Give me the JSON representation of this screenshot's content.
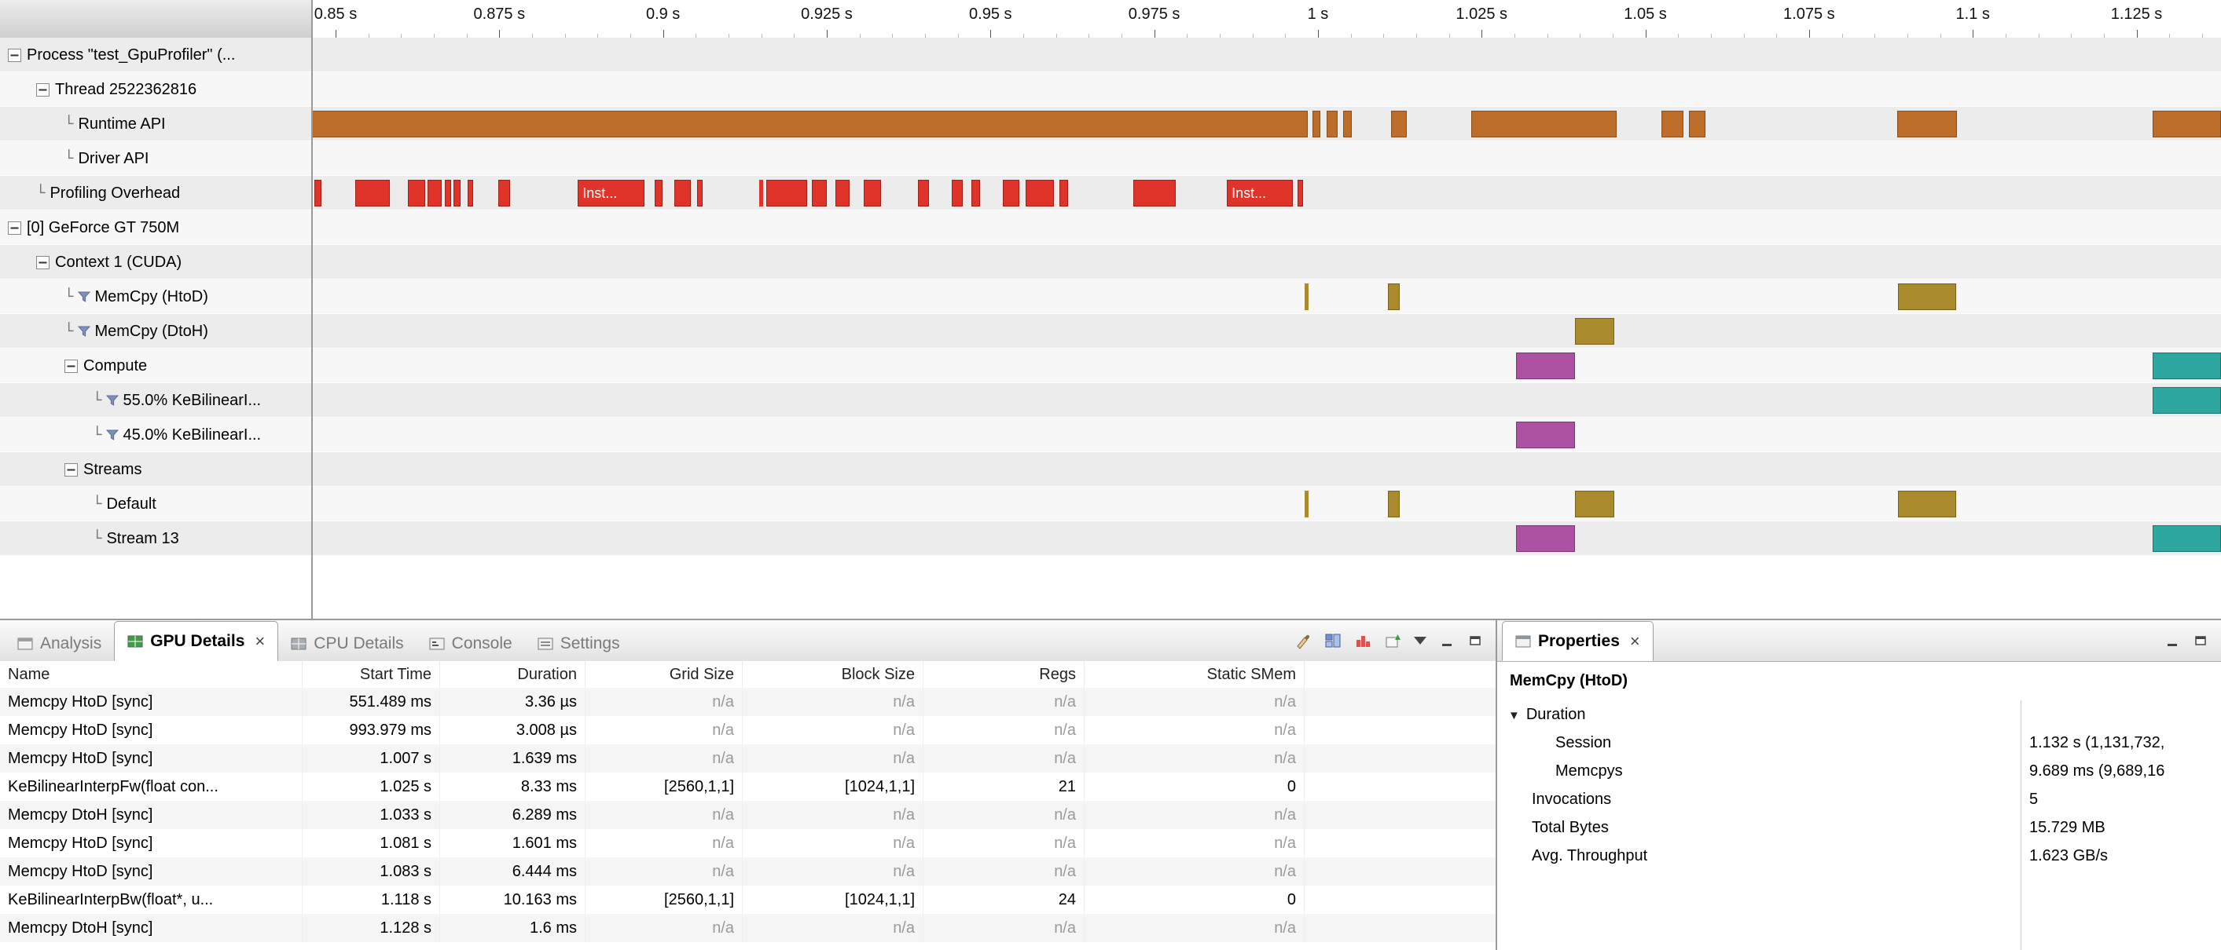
{
  "glyphs": {
    "close": "×",
    "leaf": "└",
    "arrow": "▼"
  },
  "palette": {
    "stripe_even": "#ececec",
    "stripe_odd": "#f7f7f7",
    "runtime": {
      "fill": "#bc6d2a",
      "edge": "#8a4e1c"
    },
    "overhead": {
      "fill": "#e0342a",
      "edge": "#9e2218"
    },
    "memcpy": {
      "fill": "#a98a2c",
      "edge": "#7a621e"
    },
    "kernel45": {
      "fill": "#ad51a2",
      "edge": "#7b3973"
    },
    "kernel55": {
      "fill": "#2da7a0",
      "edge": "#1d746f"
    }
  },
  "timeline": {
    "axis": {
      "start": 0.8464,
      "end": 1.1379
    },
    "ruler_ticks": [
      {
        "t": 0.85,
        "label": "0.85 s"
      },
      {
        "t": 0.875,
        "label": "0.875 s"
      },
      {
        "t": 0.9,
        "label": "0.9 s"
      },
      {
        "t": 0.925,
        "label": "0.925 s"
      },
      {
        "t": 0.95,
        "label": "0.95 s"
      },
      {
        "t": 0.975,
        "label": "0.975 s"
      },
      {
        "t": 1.0,
        "label": "1 s"
      },
      {
        "t": 1.025,
        "label": "1.025 s"
      },
      {
        "t": 1.05,
        "label": "1.05 s"
      },
      {
        "t": 1.075,
        "label": "1.075 s"
      },
      {
        "t": 1.1,
        "label": "1.1 s"
      },
      {
        "t": 1.125,
        "label": "1.125 s"
      }
    ],
    "rows": [
      {
        "id": "process",
        "label": "Process \"test_GpuProfiler\" (...",
        "depth": 0,
        "icon": "minus",
        "bars": []
      },
      {
        "id": "thread",
        "label": "Thread 2522362816",
        "depth": 1,
        "icon": "minus",
        "bars": []
      },
      {
        "id": "runtime-api",
        "label": "Runtime API",
        "depth": 2,
        "icon": "leaf",
        "bars": [
          {
            "s": 0.8464,
            "e": 0.9985,
            "c": "runtime"
          },
          {
            "s": 0.9992,
            "e": 1.0004,
            "c": "runtime"
          },
          {
            "s": 1.0013,
            "e": 1.003,
            "c": "runtime"
          },
          {
            "s": 1.0038,
            "e": 1.0052,
            "c": "runtime"
          },
          {
            "s": 1.0112,
            "e": 1.0136,
            "c": "runtime"
          },
          {
            "s": 1.0234,
            "e": 1.0456,
            "c": "runtime"
          },
          {
            "s": 1.0524,
            "e": 1.0558,
            "c": "runtime"
          },
          {
            "s": 1.0566,
            "e": 1.0592,
            "c": "runtime"
          },
          {
            "s": 1.0884,
            "e": 1.0976,
            "c": "runtime"
          },
          {
            "s": 1.1274,
            "e": 1.1379,
            "c": "runtime"
          }
        ]
      },
      {
        "id": "driver-api",
        "label": "Driver API",
        "depth": 2,
        "icon": "leaf",
        "bars": []
      },
      {
        "id": "profiling-overhead",
        "label": "Profiling Overhead",
        "depth": 1,
        "icon": "leaf",
        "bars": [
          {
            "s": 0.8468,
            "e": 0.8478,
            "c": "overhead"
          },
          {
            "s": 0.853,
            "e": 0.8583,
            "c": "overhead"
          },
          {
            "s": 0.861,
            "e": 0.8637,
            "c": "overhead"
          },
          {
            "s": 0.8641,
            "e": 0.8662,
            "c": "overhead"
          },
          {
            "s": 0.8667,
            "e": 0.8676,
            "c": "overhead"
          },
          {
            "s": 0.868,
            "e": 0.8691,
            "c": "overhead"
          },
          {
            "s": 0.8702,
            "e": 0.871,
            "c": "overhead"
          },
          {
            "s": 0.8748,
            "e": 0.8766,
            "c": "overhead"
          },
          {
            "s": 0.887,
            "e": 0.8972,
            "c": "overhead",
            "label": "Inst..."
          },
          {
            "s": 0.8987,
            "e": 0.8999,
            "c": "overhead"
          },
          {
            "s": 0.9017,
            "e": 0.9042,
            "c": "overhead"
          },
          {
            "s": 0.9052,
            "e": 0.9061,
            "c": "overhead"
          },
          {
            "s": 0.9147,
            "e": 0.9153,
            "c": "overhead"
          },
          {
            "s": 0.9158,
            "e": 0.922,
            "c": "overhead"
          },
          {
            "s": 0.9227,
            "e": 0.925,
            "c": "overhead"
          },
          {
            "s": 0.9263,
            "e": 0.9285,
            "c": "overhead"
          },
          {
            "s": 0.9306,
            "e": 0.9333,
            "c": "overhead"
          },
          {
            "s": 0.9389,
            "e": 0.9406,
            "c": "overhead"
          },
          {
            "s": 0.9441,
            "e": 0.9458,
            "c": "overhead"
          },
          {
            "s": 0.9471,
            "e": 0.9484,
            "c": "overhead"
          },
          {
            "s": 0.9519,
            "e": 0.9544,
            "c": "overhead"
          },
          {
            "s": 0.9554,
            "e": 0.9597,
            "c": "overhead"
          },
          {
            "s": 0.9605,
            "e": 0.9618,
            "c": "overhead"
          },
          {
            "s": 0.9718,
            "e": 0.9783,
            "c": "overhead"
          },
          {
            "s": 0.9861,
            "e": 0.9962,
            "c": "overhead",
            "label": "Inst..."
          },
          {
            "s": 0.9969,
            "e": 0.9977,
            "c": "overhead"
          }
        ]
      },
      {
        "id": "gpu",
        "label": "[0] GeForce GT 750M",
        "depth": 0,
        "icon": "minus",
        "bars": []
      },
      {
        "id": "context",
        "label": "Context 1 (CUDA)",
        "depth": 1,
        "icon": "minus",
        "bars": []
      },
      {
        "id": "memcpy-htod",
        "label": "MemCpy (HtoD)",
        "depth": 2,
        "icon": "leaf",
        "filter": true,
        "bars": [
          {
            "s": 0.998,
            "e": 0.9984,
            "c": "memcpy"
          },
          {
            "s": 1.0107,
            "e": 1.0125,
            "c": "memcpy"
          },
          {
            "s": 1.0886,
            "e": 1.0975,
            "c": "memcpy"
          }
        ]
      },
      {
        "id": "memcpy-dtoh",
        "label": "MemCpy (DtoH)",
        "depth": 2,
        "icon": "leaf",
        "filter": true,
        "bars": [
          {
            "s": 1.0393,
            "e": 1.0453,
            "c": "memcpy"
          }
        ]
      },
      {
        "id": "compute",
        "label": "Compute",
        "depth": 2,
        "icon": "minus",
        "bars": [
          {
            "s": 1.0302,
            "e": 1.0393,
            "c": "kernel45"
          },
          {
            "s": 1.1275,
            "e": 1.1379,
            "c": "kernel55"
          }
        ]
      },
      {
        "id": "kernel-55",
        "label": "55.0% KeBilinearI...",
        "depth": 3,
        "icon": "leaf",
        "filter": true,
        "bars": [
          {
            "s": 1.1275,
            "e": 1.1379,
            "c": "kernel55"
          }
        ]
      },
      {
        "id": "kernel-45",
        "label": "45.0% KeBilinearI...",
        "depth": 3,
        "icon": "leaf",
        "filter": true,
        "bars": [
          {
            "s": 1.0302,
            "e": 1.0393,
            "c": "kernel45"
          }
        ]
      },
      {
        "id": "streams",
        "label": "Streams",
        "depth": 2,
        "icon": "minus",
        "bars": []
      },
      {
        "id": "stream-default",
        "label": "Default",
        "depth": 3,
        "icon": "leaf",
        "bars": [
          {
            "s": 0.998,
            "e": 0.9984,
            "c": "memcpy"
          },
          {
            "s": 1.0107,
            "e": 1.0125,
            "c": "memcpy"
          },
          {
            "s": 1.0393,
            "e": 1.0453,
            "c": "memcpy"
          },
          {
            "s": 1.0886,
            "e": 1.0975,
            "c": "memcpy"
          }
        ]
      },
      {
        "id": "stream-13",
        "label": "Stream 13",
        "depth": 3,
        "icon": "leaf",
        "bars": [
          {
            "s": 1.0302,
            "e": 1.0393,
            "c": "kernel45"
          },
          {
            "s": 1.1275,
            "e": 1.1379,
            "c": "kernel55"
          }
        ]
      }
    ]
  },
  "bottom_left": {
    "tabs": [
      {
        "label": "Analysis",
        "icon": "analysis-icon",
        "active": false
      },
      {
        "label": "GPU Details",
        "icon": "gpu-details-icon",
        "active": true,
        "closable": true
      },
      {
        "label": "CPU Details",
        "icon": "cpu-details-icon",
        "active": false
      },
      {
        "label": "Console",
        "icon": "console-icon",
        "active": false
      },
      {
        "label": "Settings",
        "icon": "settings-icon",
        "active": false
      }
    ],
    "toolbar_icons": [
      "brush-icon",
      "layout-icon",
      "profile-icon",
      "export-icon",
      "view-menu-icon",
      "minimize-icon",
      "restore-icon"
    ]
  },
  "gpu_details_table": {
    "headers": [
      "Name",
      "Start Time",
      "Duration",
      "Grid Size",
      "Block Size",
      "Regs",
      "Static SMem"
    ],
    "rows": [
      [
        "Memcpy HtoD [sync]",
        "551.489 ms",
        "3.36 µs",
        "n/a",
        "n/a",
        "n/a",
        "n/a"
      ],
      [
        "Memcpy HtoD [sync]",
        "993.979 ms",
        "3.008 µs",
        "n/a",
        "n/a",
        "n/a",
        "n/a"
      ],
      [
        "Memcpy HtoD [sync]",
        "1.007 s",
        "1.639 ms",
        "n/a",
        "n/a",
        "n/a",
        "n/a"
      ],
      [
        "KeBilinearInterpFw(float con...",
        "1.025 s",
        "8.33 ms",
        "[2560,1,1]",
        "[1024,1,1]",
        "21",
        "0"
      ],
      [
        "Memcpy DtoH [sync]",
        "1.033 s",
        "6.289 ms",
        "n/a",
        "n/a",
        "n/a",
        "n/a"
      ],
      [
        "Memcpy HtoD [sync]",
        "1.081 s",
        "1.601 ms",
        "n/a",
        "n/a",
        "n/a",
        "n/a"
      ],
      [
        "Memcpy HtoD [sync]",
        "1.083 s",
        "6.444 ms",
        "n/a",
        "n/a",
        "n/a",
        "n/a"
      ],
      [
        "KeBilinearInterpBw(float*, u...",
        "1.118 s",
        "10.163 ms",
        "[2560,1,1]",
        "[1024,1,1]",
        "24",
        "0"
      ],
      [
        "Memcpy DtoH [sync]",
        "1.128 s",
        "1.6 ms",
        "n/a",
        "n/a",
        "n/a",
        "n/a"
      ]
    ]
  },
  "properties": {
    "tab_label": "Properties",
    "title": "MemCpy (HtoD)",
    "window_icons": [
      "minimize-icon",
      "restore-icon"
    ],
    "rows": [
      {
        "label": "Duration",
        "value": "",
        "level": 0,
        "arrow": true
      },
      {
        "label": "Session",
        "value": "1.132 s (1,131,732,",
        "level": 2
      },
      {
        "label": "Memcpys",
        "value": "9.689 ms (9,689,16",
        "level": 2
      },
      {
        "label": "Invocations",
        "value": "5",
        "level": 1
      },
      {
        "label": "Total Bytes",
        "value": "15.729 MB",
        "level": 1
      },
      {
        "label": "Avg. Throughput",
        "value": "1.623 GB/s",
        "level": 1
      }
    ]
  }
}
